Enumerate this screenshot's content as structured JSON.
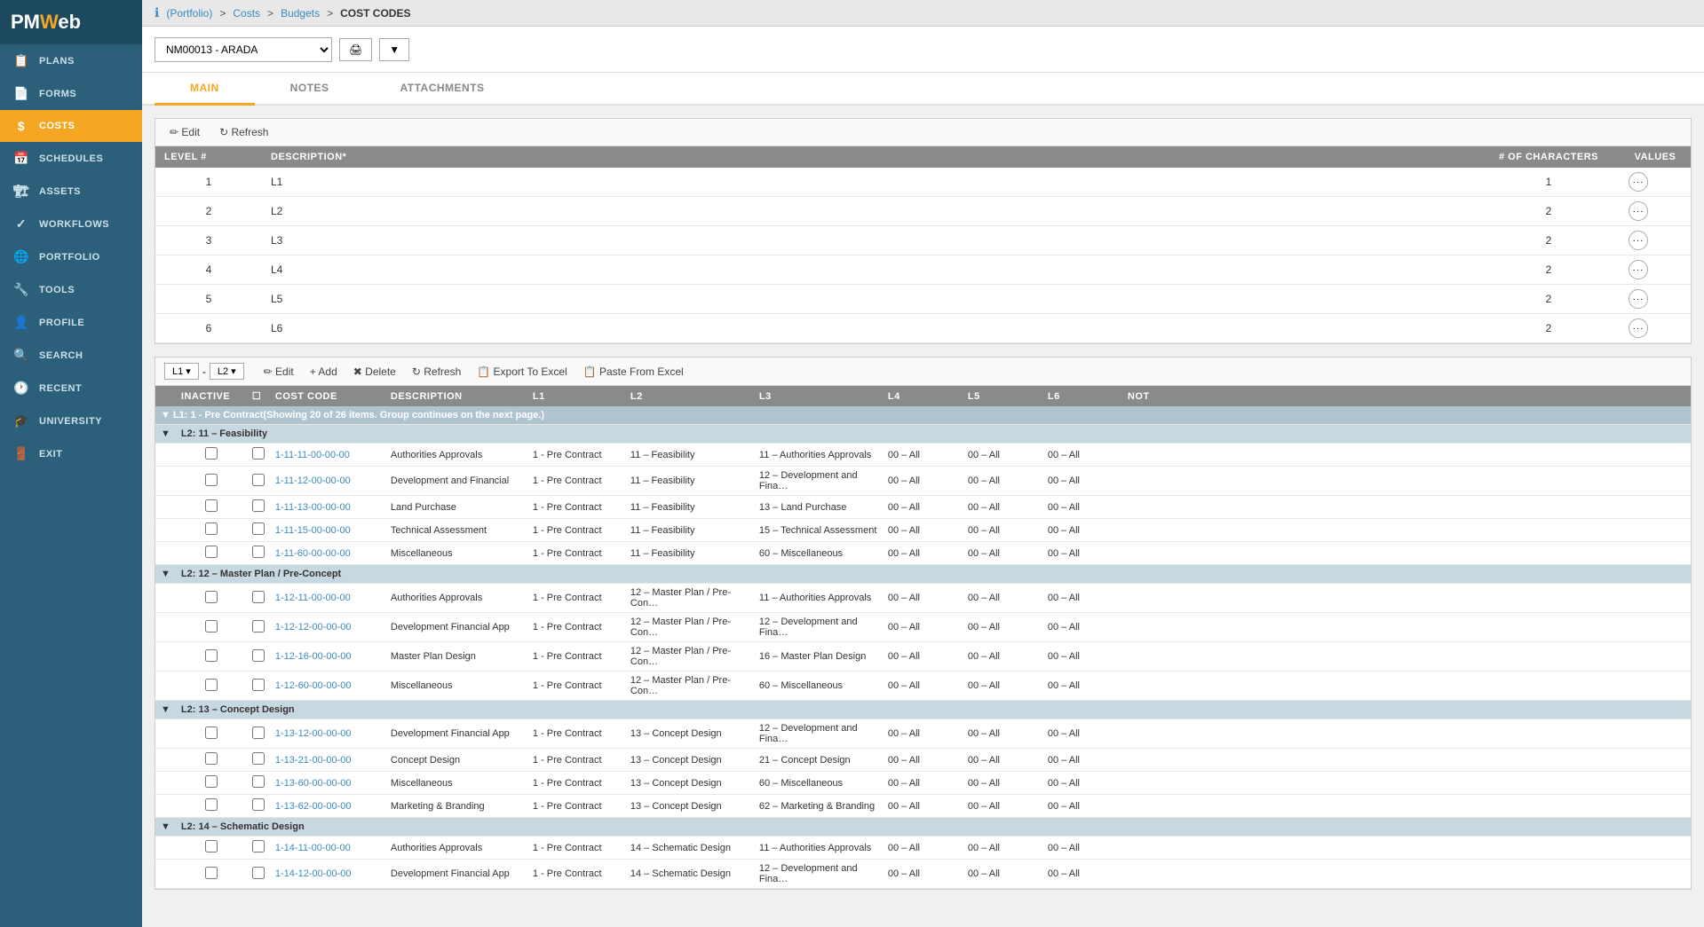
{
  "app": {
    "logo": "PMWeb",
    "logo_accent": "W"
  },
  "breadcrumb": {
    "info_icon": "ℹ",
    "portfolio_label": "(Portfolio)",
    "sep1": ">",
    "costs_label": "Costs",
    "sep2": ">",
    "budgets_label": "Budgets",
    "sep3": ">",
    "current": "COST CODES"
  },
  "project_selector": {
    "value": "NM00013 - ARADA",
    "placeholder": "NM00013 - ARADA"
  },
  "toolbar": {
    "print_label": "🖨",
    "dropdown_arrow": "▼"
  },
  "tabs": [
    {
      "id": "main",
      "label": "MAIN",
      "active": true
    },
    {
      "id": "notes",
      "label": "NOTES",
      "active": false
    },
    {
      "id": "attachments",
      "label": "ATTACHMENTS",
      "active": false
    }
  ],
  "levels_table": {
    "edit_label": "✏ Edit",
    "refresh_label": "↻ Refresh",
    "columns": [
      "LEVEL #",
      "DESCRIPTION*",
      "# OF CHARACTERS",
      "VALUES"
    ],
    "rows": [
      {
        "level": 1,
        "description": "L1",
        "characters": 1,
        "values": "···"
      },
      {
        "level": 2,
        "description": "L2",
        "characters": 2,
        "values": "···"
      },
      {
        "level": 3,
        "description": "L3",
        "characters": 2,
        "values": "···"
      },
      {
        "level": 4,
        "description": "L4",
        "characters": 2,
        "values": "···"
      },
      {
        "level": 5,
        "description": "L5",
        "characters": 2,
        "values": "···"
      },
      {
        "level": 6,
        "description": "L6",
        "characters": 2,
        "values": "···"
      }
    ]
  },
  "cost_codes_table": {
    "level_selector": [
      "L1",
      "L2"
    ],
    "toolbar": {
      "edit": "✏ Edit",
      "add": "+ Add",
      "delete": "✖ Delete",
      "refresh": "↻ Refresh",
      "export": "📋 Export To Excel",
      "paste": "📋 Paste From Excel"
    },
    "columns": [
      "INACTIVE",
      "",
      "COST CODE",
      "DESCRIPTION",
      "L1",
      "L2",
      "L3",
      "L4",
      "L5",
      "L6",
      "NOT"
    ],
    "group_header": "L1: 1 - Pre Contract(Showing 20 of 26 items. Group continues on the next page.)",
    "sub_groups": [
      {
        "label": "L2: 11 – Feasibility",
        "rows": [
          {
            "code": "1-11-11-00-00-00",
            "description": "Authorities Approvals",
            "l1": "1 - Pre Contract",
            "l2": "11 – Feasibility",
            "l3": "11 – Authorities Approvals",
            "l4": "00 – All",
            "l5": "00 – All",
            "l6": "00 – All"
          },
          {
            "code": "1-11-12-00-00-00",
            "description": "Development and Financial",
            "l1": "1 - Pre Contract",
            "l2": "11 – Feasibility",
            "l3": "12 – Development and Fina…",
            "l4": "00 – All",
            "l5": "00 – All",
            "l6": "00 – All"
          },
          {
            "code": "1-11-13-00-00-00",
            "description": "Land Purchase",
            "l1": "1 - Pre Contract",
            "l2": "11 – Feasibility",
            "l3": "13 – Land Purchase",
            "l4": "00 – All",
            "l5": "00 – All",
            "l6": "00 – All"
          },
          {
            "code": "1-11-15-00-00-00",
            "description": "Technical Assessment",
            "l1": "1 - Pre Contract",
            "l2": "11 – Feasibility",
            "l3": "15 – Technical Assessment",
            "l4": "00 – All",
            "l5": "00 – All",
            "l6": "00 – All"
          },
          {
            "code": "1-11-60-00-00-00",
            "description": "Miscellaneous",
            "l1": "1 - Pre Contract",
            "l2": "11 – Feasibility",
            "l3": "60 – Miscellaneous",
            "l4": "00 – All",
            "l5": "00 – All",
            "l6": "00 – All"
          }
        ]
      },
      {
        "label": "L2: 12 – Master Plan / Pre-Concept",
        "rows": [
          {
            "code": "1-12-11-00-00-00",
            "description": "Authorities Approvals",
            "l1": "1 - Pre Contract",
            "l2": "12 – Master Plan / Pre-Con…",
            "l3": "11 – Authorities Approvals",
            "l4": "00 – All",
            "l5": "00 – All",
            "l6": "00 – All"
          },
          {
            "code": "1-12-12-00-00-00",
            "description": "Development Financial App",
            "l1": "1 - Pre Contract",
            "l2": "12 – Master Plan / Pre-Con…",
            "l3": "12 – Development and Fina…",
            "l4": "00 – All",
            "l5": "00 – All",
            "l6": "00 – All"
          },
          {
            "code": "1-12-16-00-00-00",
            "description": "Master Plan Design",
            "l1": "1 - Pre Contract",
            "l2": "12 – Master Plan / Pre-Con…",
            "l3": "16 – Master Plan Design",
            "l4": "00 – All",
            "l5": "00 – All",
            "l6": "00 – All"
          },
          {
            "code": "1-12-60-00-00-00",
            "description": "Miscellaneous",
            "l1": "1 - Pre Contract",
            "l2": "12 – Master Plan / Pre-Con…",
            "l3": "60 – Miscellaneous",
            "l4": "00 – All",
            "l5": "00 – All",
            "l6": "00 – All"
          }
        ]
      },
      {
        "label": "L2: 13 – Concept Design",
        "rows": [
          {
            "code": "1-13-12-00-00-00",
            "description": "Development Financial App",
            "l1": "1 - Pre Contract",
            "l2": "13 – Concept Design",
            "l3": "12 – Development and Fina…",
            "l4": "00 – All",
            "l5": "00 – All",
            "l6": "00 – All"
          },
          {
            "code": "1-13-21-00-00-00",
            "description": "Concept Design",
            "l1": "1 - Pre Contract",
            "l2": "13 – Concept Design",
            "l3": "21 – Concept Design",
            "l4": "00 – All",
            "l5": "00 – All",
            "l6": "00 – All"
          },
          {
            "code": "1-13-60-00-00-00",
            "description": "Miscellaneous",
            "l1": "1 - Pre Contract",
            "l2": "13 – Concept Design",
            "l3": "60 – Miscellaneous",
            "l4": "00 – All",
            "l5": "00 – All",
            "l6": "00 – All"
          },
          {
            "code": "1-13-62-00-00-00",
            "description": "Marketing & Branding",
            "l1": "1 - Pre Contract",
            "l2": "13 – Concept Design",
            "l3": "62 – Marketing & Branding",
            "l4": "00 – All",
            "l5": "00 – All",
            "l6": "00 – All"
          }
        ]
      },
      {
        "label": "L2: 14 – Schematic Design",
        "rows": [
          {
            "code": "1-14-11-00-00-00",
            "description": "Authorities Approvals",
            "l1": "1 - Pre Contract",
            "l2": "14 – Schematic Design",
            "l3": "11 – Authorities Approvals",
            "l4": "00 – All",
            "l5": "00 – All",
            "l6": "00 – All"
          },
          {
            "code": "1-14-12-00-00-00",
            "description": "Development Financial App",
            "l1": "1 - Pre Contract",
            "l2": "14 – Schematic Design",
            "l3": "12 – Development and Fina…",
            "l4": "00 – All",
            "l5": "00 – All",
            "l6": "00 – All"
          }
        ]
      }
    ],
    "footer_note": "11 - Authorities Approvals"
  },
  "sidebar": {
    "items": [
      {
        "id": "plans",
        "label": "PLANS",
        "icon": "📋"
      },
      {
        "id": "forms",
        "label": "FORMS",
        "icon": "📄"
      },
      {
        "id": "costs",
        "label": "COSTS",
        "icon": "$",
        "active": true
      },
      {
        "id": "schedules",
        "label": "SCHEDULES",
        "icon": "📅"
      },
      {
        "id": "assets",
        "label": "ASSETS",
        "icon": "🏗"
      },
      {
        "id": "workflows",
        "label": "WORKFLOWS",
        "icon": "✓"
      },
      {
        "id": "portfolio",
        "label": "PORTFOLIO",
        "icon": "🌐"
      },
      {
        "id": "tools",
        "label": "TOOLS",
        "icon": "🔧"
      },
      {
        "id": "profile",
        "label": "PROFILE",
        "icon": "👤"
      },
      {
        "id": "search",
        "label": "SEARCH",
        "icon": "🔍"
      },
      {
        "id": "recent",
        "label": "RECENT",
        "icon": "🕐"
      },
      {
        "id": "university",
        "label": "UNIVERSITY",
        "icon": "🎓"
      },
      {
        "id": "exit",
        "label": "EXIT",
        "icon": "🚪"
      }
    ]
  }
}
